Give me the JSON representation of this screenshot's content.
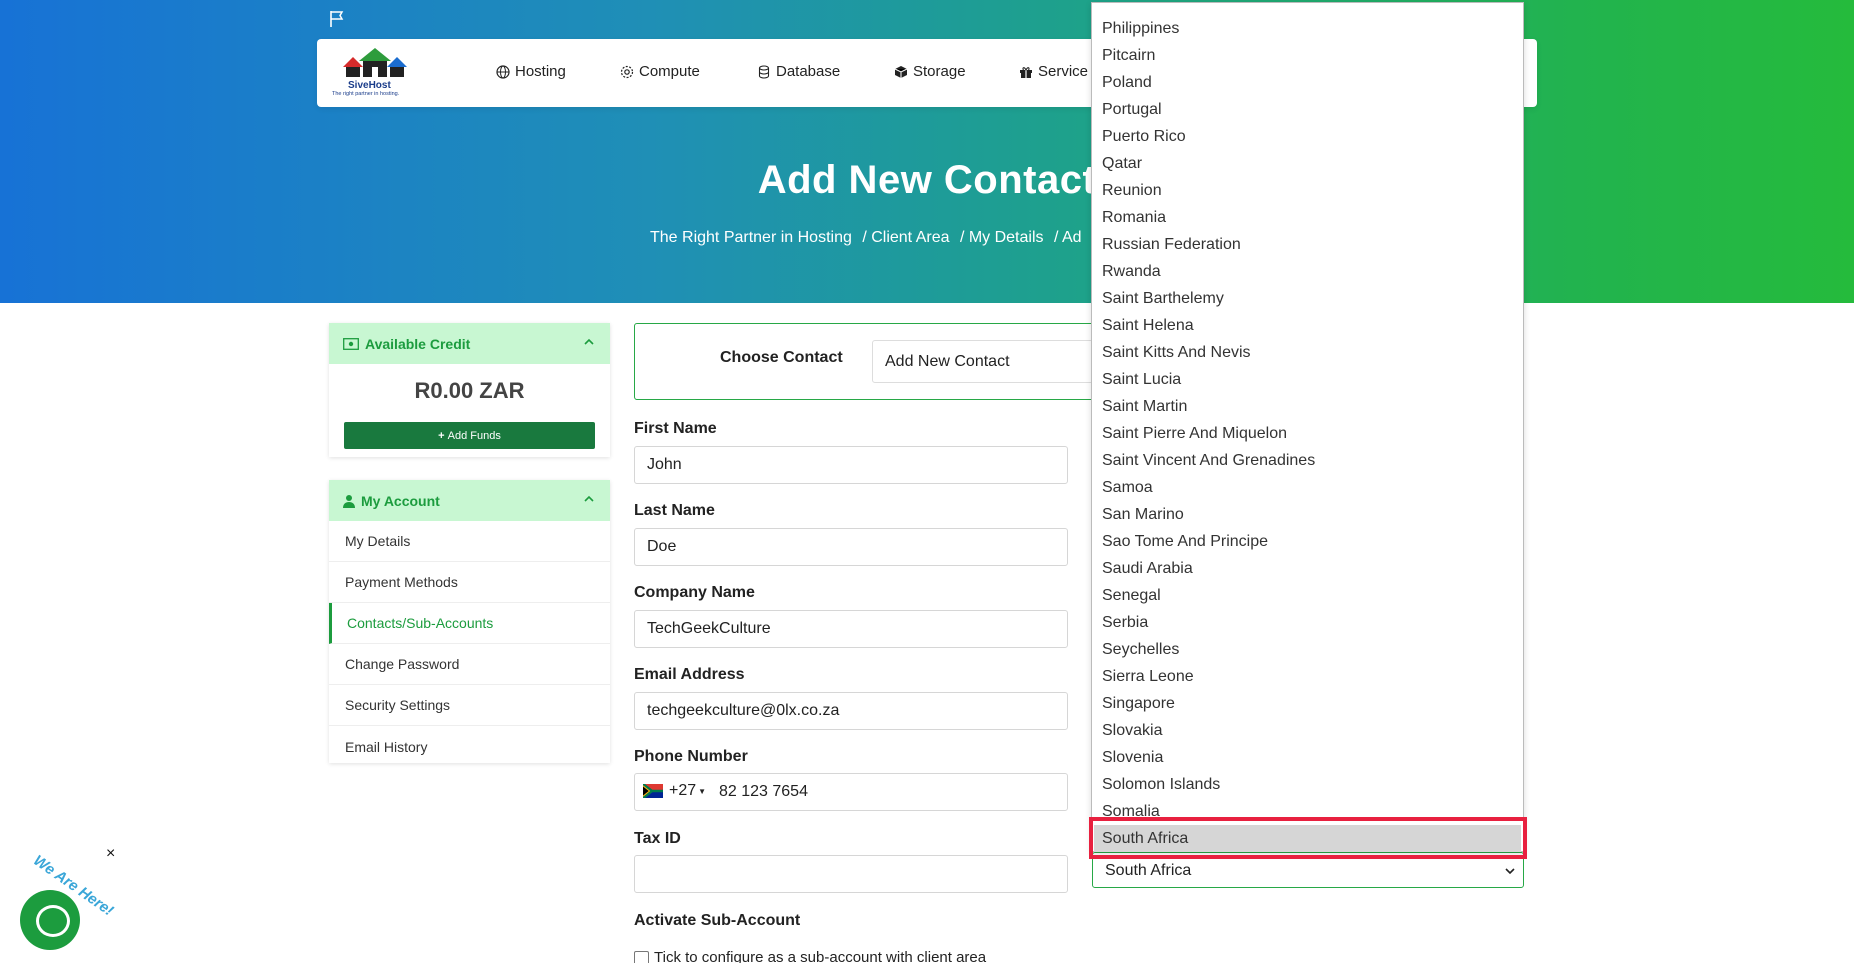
{
  "nav": {
    "brand_name": "SiveHost",
    "brand_tagline": "The right partner in hosting.",
    "items": [
      {
        "label": "Hosting",
        "icon": "globe-icon"
      },
      {
        "label": "Compute",
        "icon": "gear-icon"
      },
      {
        "label": "Database",
        "icon": "database-icon"
      },
      {
        "label": "Storage",
        "icon": "box-icon"
      },
      {
        "label": "Service",
        "icon": "gift-icon"
      }
    ]
  },
  "header": {
    "title": "Add New Contact",
    "breadcrumb": [
      "The Right Partner in Hosting",
      "/ Client Area",
      "/ My Details",
      "/ Ad"
    ]
  },
  "sidebar": {
    "credit": {
      "title": "Available Credit",
      "amount": "R0.00 ZAR",
      "add_funds": "Add Funds"
    },
    "account": {
      "title": "My Account",
      "items": [
        "My Details",
        "Payment Methods",
        "Contacts/Sub-Accounts",
        "Change Password",
        "Security Settings",
        "Email History"
      ],
      "active_index": 2
    }
  },
  "form": {
    "choose_contact_label": "Choose Contact",
    "choose_contact_value": "Add New Contact",
    "first_name_label": "First Name",
    "first_name": "John",
    "last_name_label": "Last Name",
    "last_name": "Doe",
    "company_label": "Company Name",
    "company": "TechGeekCulture",
    "email_label": "Email Address",
    "email": "techgeekculture@0lx.co.za",
    "phone_label": "Phone Number",
    "phone_code": "+27",
    "phone_number": "82 123 7654",
    "tax_label": "Tax ID",
    "tax_id": "",
    "activate_label": "Activate Sub-Account",
    "activate_checkbox_label": "Tick to configure as a sub-account with client area",
    "country_value": "South Africa"
  },
  "dropdown": {
    "options": [
      "Philippines",
      "Pitcairn",
      "Poland",
      "Portugal",
      "Puerto Rico",
      "Qatar",
      "Reunion",
      "Romania",
      "Russian Federation",
      "Rwanda",
      "Saint Barthelemy",
      "Saint Helena",
      "Saint Kitts And Nevis",
      "Saint Lucia",
      "Saint Martin",
      "Saint Pierre And Miquelon",
      "Saint Vincent And Grenadines",
      "Samoa",
      "San Marino",
      "Sao Tome And Principe",
      "Saudi Arabia",
      "Senegal",
      "Serbia",
      "Seychelles",
      "Sierra Leone",
      "Singapore",
      "Slovakia",
      "Slovenia",
      "Solomon Islands",
      "Somalia",
      "South Africa"
    ],
    "highlighted": "South Africa"
  },
  "chat": {
    "label": "We Are Here!",
    "close": "×"
  },
  "colors": {
    "accent_green": "#1c9c3e",
    "dark_green": "#19793e",
    "highlight_red": "#e8203f"
  }
}
